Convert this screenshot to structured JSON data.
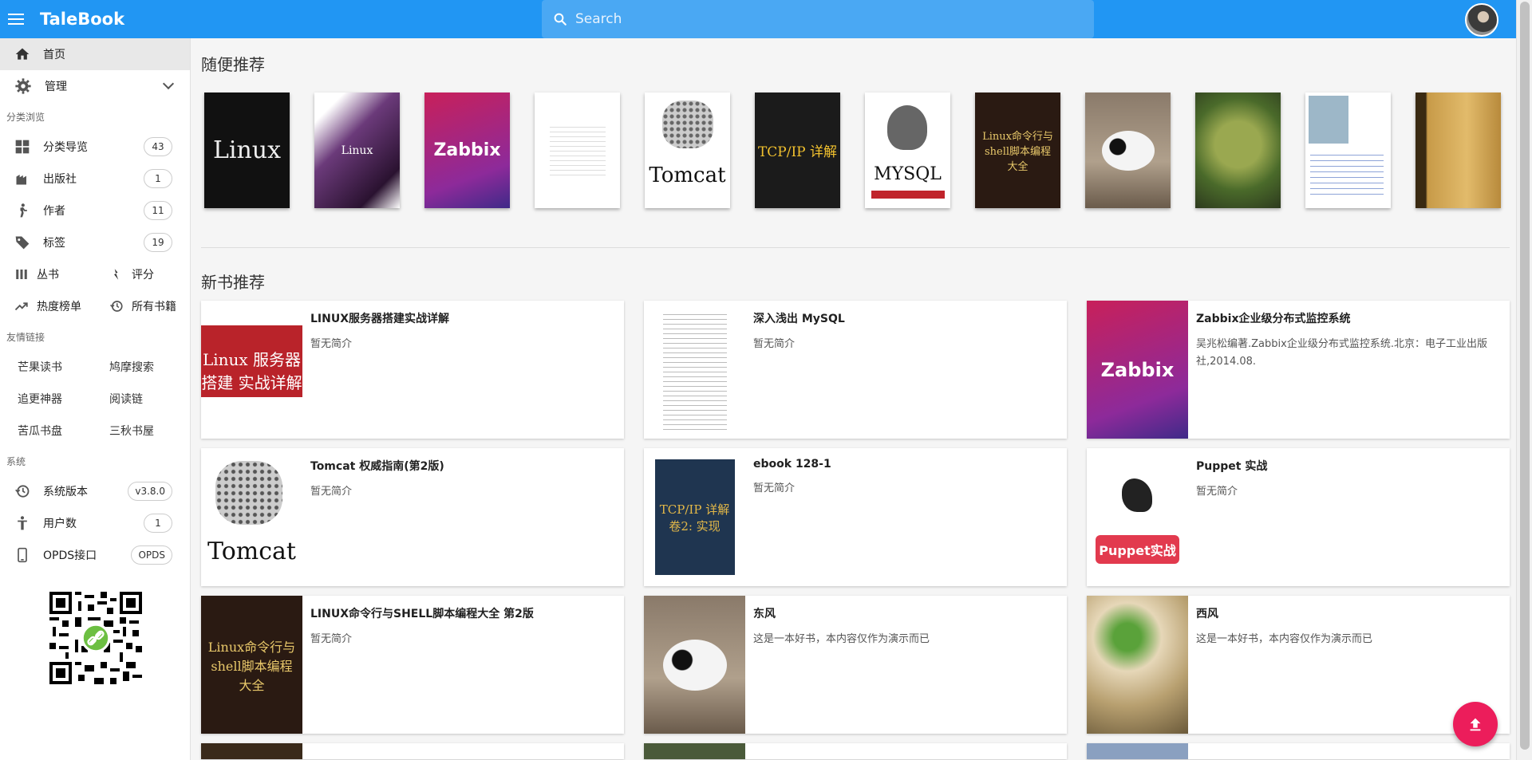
{
  "app": {
    "title": "TaleBook"
  },
  "search": {
    "placeholder": "Search"
  },
  "sidebar": {
    "home": "首页",
    "manage": "管理",
    "browse_head": "分类浏览",
    "browse": [
      {
        "label": "分类导览",
        "count": "43",
        "icon": "grid-icon"
      },
      {
        "label": "出版社",
        "count": "1",
        "icon": "building-icon"
      },
      {
        "label": "作者",
        "count": "11",
        "icon": "person-walking-icon"
      },
      {
        "label": "标签",
        "count": "19",
        "icon": "tag-icon"
      }
    ],
    "series": "丛书",
    "rating": "评分",
    "hot": "热度榜单",
    "all_books": "所有书籍",
    "friends_head": "友情链接",
    "friends": [
      "芒果读书",
      "鸠摩搜索",
      "追更神器",
      "阅读链",
      "苦瓜书盘",
      "三秋书屋"
    ],
    "system_head": "系统",
    "system": [
      {
        "label": "系统版本",
        "count": "v3.8.0",
        "icon": "history-icon"
      },
      {
        "label": "用户数",
        "count": "1",
        "icon": "person-icon"
      },
      {
        "label": "OPDS接口",
        "count": "OPDS",
        "icon": "phone-icon"
      }
    ]
  },
  "random": {
    "title": "随便推荐",
    "covers": [
      {
        "name": "linux-cover",
        "text": "Linux"
      },
      {
        "name": "linux2-cover",
        "text": "Linux"
      },
      {
        "name": "zabbix-cover",
        "text": "Zabbix"
      },
      {
        "name": "doc-cover",
        "text": ""
      },
      {
        "name": "tomcat-cover",
        "text": "Tomcat"
      },
      {
        "name": "tcpip-cover",
        "text": "TCP/IP 详解"
      },
      {
        "name": "mysql-cover",
        "text": "MYSQL"
      },
      {
        "name": "linux-shell-cover",
        "text": "Linux命令行与shell脚本编程大全"
      },
      {
        "name": "panda-cover",
        "text": ""
      },
      {
        "name": "parrot-cover",
        "text": ""
      },
      {
        "name": "web-cover",
        "text": ""
      },
      {
        "name": "default-book-cover",
        "text": ""
      }
    ]
  },
  "new": {
    "title": "新书推荐",
    "books": [
      {
        "title": "LINUX服务器搭建实战详解",
        "desc": "暂无简介",
        "cover_text": "Linux 服务器搭建 实战详解"
      },
      {
        "title": "深入浅出 MySQL",
        "desc": "暂无简介",
        "cover_text": ""
      },
      {
        "title": "Zabbix企业级分布式监控系统",
        "desc": "吴兆松编著.Zabbix企业级分布式监控系统.北京：电子工业出版社,2014.08.",
        "cover_text": "Zabbix"
      },
      {
        "title": "Tomcat 权威指南(第2版)",
        "desc": "暂无简介",
        "cover_text": "Tomcat"
      },
      {
        "title": "ebook 128-1",
        "desc": "暂无简介",
        "cover_text": "TCP/IP 详解 卷2: 实现"
      },
      {
        "title": "Puppet 实战",
        "desc": "暂无简介",
        "cover_text": "Puppet实战"
      },
      {
        "title": "LINUX命令行与SHELL脚本编程大全 第2版",
        "desc": "暂无简介",
        "cover_text": "Linux命令行与shell脚本编程大全"
      },
      {
        "title": "东风",
        "desc": "这是一本好书，本内容仅作为演示而已",
        "cover_text": ""
      },
      {
        "title": "西风",
        "desc": "这是一本好书，本内容仅作为演示而已",
        "cover_text": ""
      }
    ]
  },
  "colors": {
    "primary": "#2196f3",
    "fab": "#ec1d5b"
  }
}
